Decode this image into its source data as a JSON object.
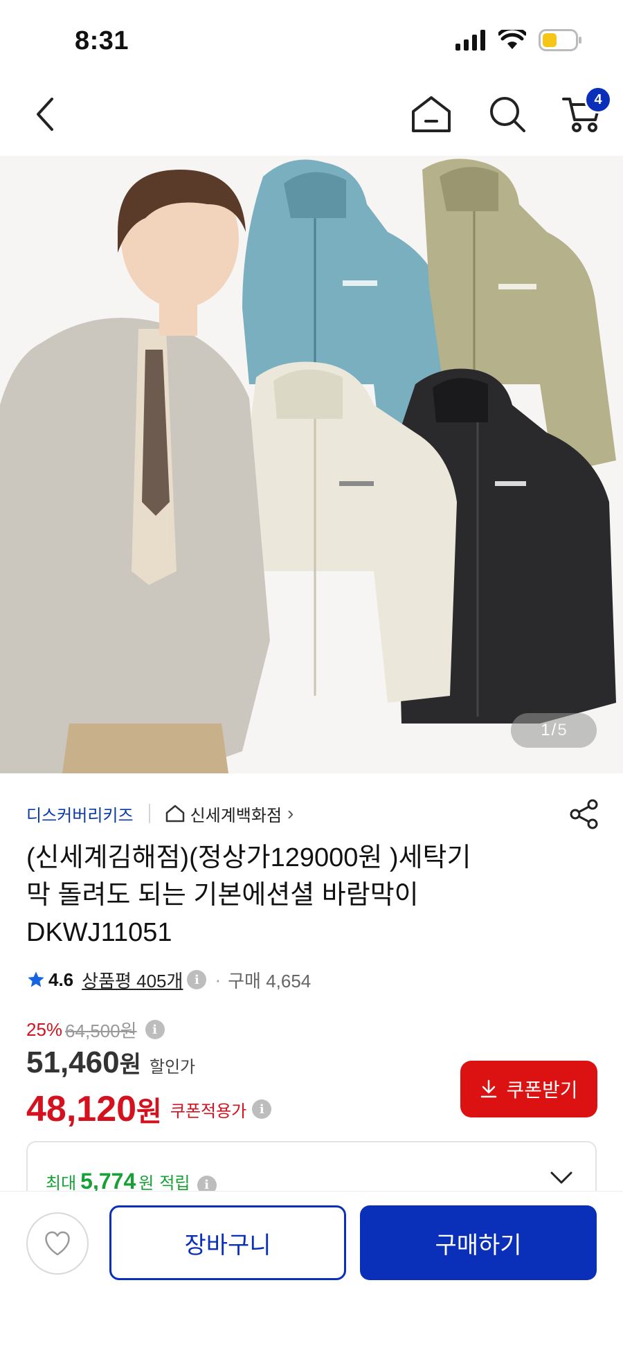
{
  "status_bar": {
    "time": "8:31"
  },
  "header": {
    "cart_count": "4"
  },
  "gallery": {
    "current": "1",
    "separator": "/",
    "total": "5"
  },
  "store": {
    "brand": "디스커버리키즈",
    "store_name": "신세계백화점",
    "chevron": "›"
  },
  "product": {
    "title_line1": "(신세계김해점)(정상가129000원 )세탁기",
    "title_line2": "막 돌려도 되는 기본에션셜 바람막이",
    "title_line3": "DKWJ11051"
  },
  "rating": {
    "score": "4.6",
    "review_label": "상품평 405개",
    "separator": "·",
    "purchase_label": "구매 4,654"
  },
  "price": {
    "discount_rate": "25%",
    "original_price": "64,500원",
    "sale_price": "51,460",
    "sale_unit": "원",
    "sale_label": "할인가",
    "coupon_price": "48,120",
    "coupon_unit": "원",
    "coupon_label": "쿠폰적용가",
    "coupon_button": "쿠폰받기"
  },
  "points": {
    "prefix": "최대",
    "value": "5,774",
    "unit": "원",
    "suffix": "적립"
  },
  "bottom_bar": {
    "cart_button": "장바구니",
    "buy_button": "구매하기"
  },
  "colors": {
    "brand_blue": "#0a2fb8",
    "sale_red": "#d4121f",
    "points_green": "#16a036"
  },
  "icons": [
    "back-icon",
    "home-icon",
    "search-icon",
    "cart-icon",
    "share-icon",
    "info-icon",
    "chevron-down-icon",
    "heart-icon",
    "download-icon",
    "star-icon"
  ]
}
